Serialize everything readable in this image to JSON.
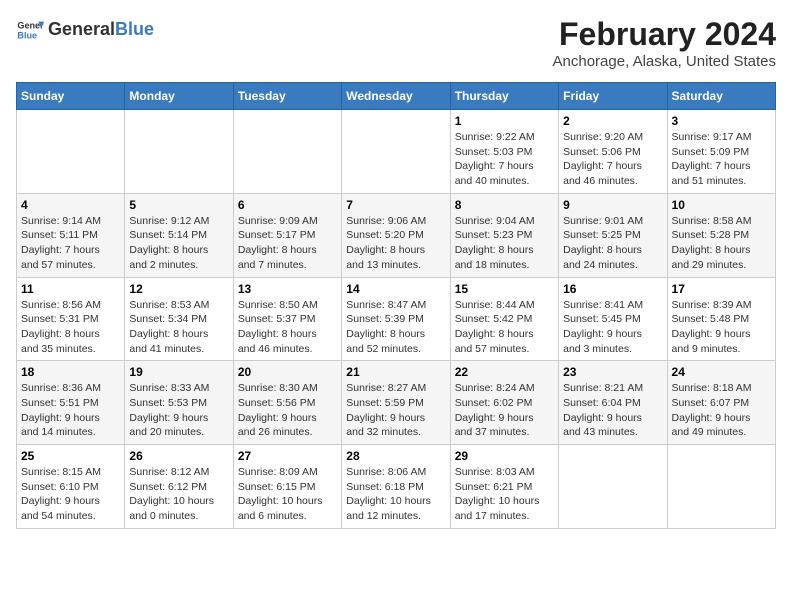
{
  "logo": {
    "general": "General",
    "blue": "Blue"
  },
  "title": "February 2024",
  "subtitle": "Anchorage, Alaska, United States",
  "weekdays": [
    "Sunday",
    "Monday",
    "Tuesday",
    "Wednesday",
    "Thursday",
    "Friday",
    "Saturday"
  ],
  "weeks": [
    [
      {
        "day": "",
        "info": ""
      },
      {
        "day": "",
        "info": ""
      },
      {
        "day": "",
        "info": ""
      },
      {
        "day": "",
        "info": ""
      },
      {
        "day": "1",
        "info": "Sunrise: 9:22 AM\nSunset: 5:03 PM\nDaylight: 7 hours\nand 40 minutes."
      },
      {
        "day": "2",
        "info": "Sunrise: 9:20 AM\nSunset: 5:06 PM\nDaylight: 7 hours\nand 46 minutes."
      },
      {
        "day": "3",
        "info": "Sunrise: 9:17 AM\nSunset: 5:09 PM\nDaylight: 7 hours\nand 51 minutes."
      }
    ],
    [
      {
        "day": "4",
        "info": "Sunrise: 9:14 AM\nSunset: 5:11 PM\nDaylight: 7 hours\nand 57 minutes."
      },
      {
        "day": "5",
        "info": "Sunrise: 9:12 AM\nSunset: 5:14 PM\nDaylight: 8 hours\nand 2 minutes."
      },
      {
        "day": "6",
        "info": "Sunrise: 9:09 AM\nSunset: 5:17 PM\nDaylight: 8 hours\nand 7 minutes."
      },
      {
        "day": "7",
        "info": "Sunrise: 9:06 AM\nSunset: 5:20 PM\nDaylight: 8 hours\nand 13 minutes."
      },
      {
        "day": "8",
        "info": "Sunrise: 9:04 AM\nSunset: 5:23 PM\nDaylight: 8 hours\nand 18 minutes."
      },
      {
        "day": "9",
        "info": "Sunrise: 9:01 AM\nSunset: 5:25 PM\nDaylight: 8 hours\nand 24 minutes."
      },
      {
        "day": "10",
        "info": "Sunrise: 8:58 AM\nSunset: 5:28 PM\nDaylight: 8 hours\nand 29 minutes."
      }
    ],
    [
      {
        "day": "11",
        "info": "Sunrise: 8:56 AM\nSunset: 5:31 PM\nDaylight: 8 hours\nand 35 minutes."
      },
      {
        "day": "12",
        "info": "Sunrise: 8:53 AM\nSunset: 5:34 PM\nDaylight: 8 hours\nand 41 minutes."
      },
      {
        "day": "13",
        "info": "Sunrise: 8:50 AM\nSunset: 5:37 PM\nDaylight: 8 hours\nand 46 minutes."
      },
      {
        "day": "14",
        "info": "Sunrise: 8:47 AM\nSunset: 5:39 PM\nDaylight: 8 hours\nand 52 minutes."
      },
      {
        "day": "15",
        "info": "Sunrise: 8:44 AM\nSunset: 5:42 PM\nDaylight: 8 hours\nand 57 minutes."
      },
      {
        "day": "16",
        "info": "Sunrise: 8:41 AM\nSunset: 5:45 PM\nDaylight: 9 hours\nand 3 minutes."
      },
      {
        "day": "17",
        "info": "Sunrise: 8:39 AM\nSunset: 5:48 PM\nDaylight: 9 hours\nand 9 minutes."
      }
    ],
    [
      {
        "day": "18",
        "info": "Sunrise: 8:36 AM\nSunset: 5:51 PM\nDaylight: 9 hours\nand 14 minutes."
      },
      {
        "day": "19",
        "info": "Sunrise: 8:33 AM\nSunset: 5:53 PM\nDaylight: 9 hours\nand 20 minutes."
      },
      {
        "day": "20",
        "info": "Sunrise: 8:30 AM\nSunset: 5:56 PM\nDaylight: 9 hours\nand 26 minutes."
      },
      {
        "day": "21",
        "info": "Sunrise: 8:27 AM\nSunset: 5:59 PM\nDaylight: 9 hours\nand 32 minutes."
      },
      {
        "day": "22",
        "info": "Sunrise: 8:24 AM\nSunset: 6:02 PM\nDaylight: 9 hours\nand 37 minutes."
      },
      {
        "day": "23",
        "info": "Sunrise: 8:21 AM\nSunset: 6:04 PM\nDaylight: 9 hours\nand 43 minutes."
      },
      {
        "day": "24",
        "info": "Sunrise: 8:18 AM\nSunset: 6:07 PM\nDaylight: 9 hours\nand 49 minutes."
      }
    ],
    [
      {
        "day": "25",
        "info": "Sunrise: 8:15 AM\nSunset: 6:10 PM\nDaylight: 9 hours\nand 54 minutes."
      },
      {
        "day": "26",
        "info": "Sunrise: 8:12 AM\nSunset: 6:12 PM\nDaylight: 10 hours\nand 0 minutes."
      },
      {
        "day": "27",
        "info": "Sunrise: 8:09 AM\nSunset: 6:15 PM\nDaylight: 10 hours\nand 6 minutes."
      },
      {
        "day": "28",
        "info": "Sunrise: 8:06 AM\nSunset: 6:18 PM\nDaylight: 10 hours\nand 12 minutes."
      },
      {
        "day": "29",
        "info": "Sunrise: 8:03 AM\nSunset: 6:21 PM\nDaylight: 10 hours\nand 17 minutes."
      },
      {
        "day": "",
        "info": ""
      },
      {
        "day": "",
        "info": ""
      }
    ]
  ]
}
